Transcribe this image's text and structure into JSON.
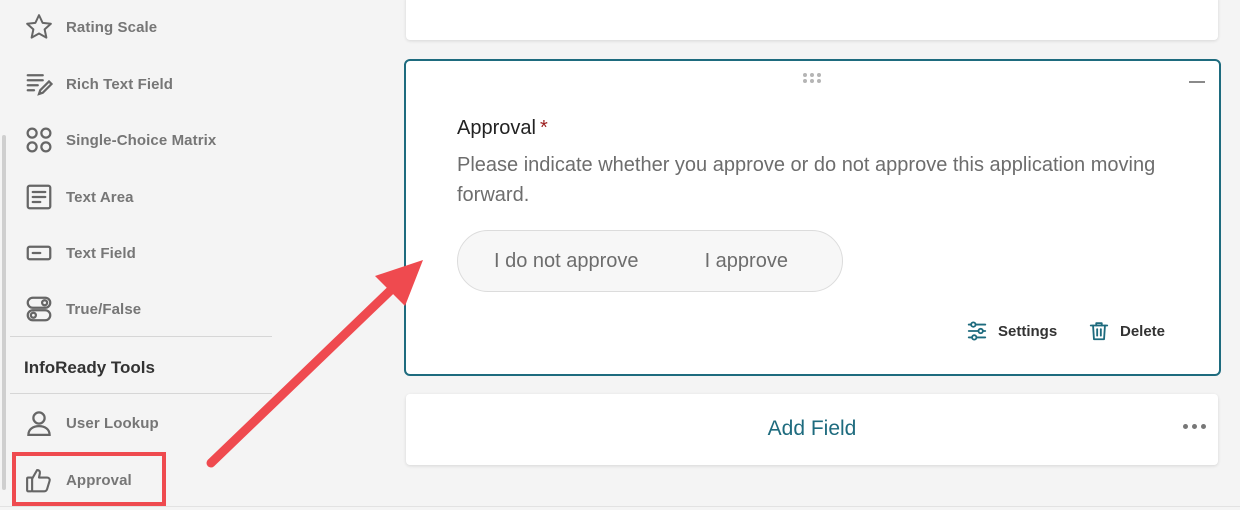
{
  "sidebar": {
    "items": [
      {
        "label": "Rating Scale",
        "icon": "star-icon"
      },
      {
        "label": "Rich Text Field",
        "icon": "rich-text-icon"
      },
      {
        "label": "Single-Choice Matrix",
        "icon": "matrix-icon"
      },
      {
        "label": "Text Area",
        "icon": "text-area-icon"
      },
      {
        "label": "Text Field",
        "icon": "text-field-icon"
      },
      {
        "label": "True/False",
        "icon": "toggle-icon"
      }
    ],
    "section_title": "InfoReady Tools",
    "tools": [
      {
        "label": "User Lookup",
        "icon": "user-icon"
      },
      {
        "label": "Approval",
        "icon": "thumbs-up-icon"
      }
    ]
  },
  "field_card": {
    "title": "Approval",
    "required_mark": "*",
    "description": "Please indicate whether you approve or do not approve this application moving forward.",
    "options": [
      "I do not approve",
      "I approve"
    ],
    "settings_label": "Settings",
    "delete_label": "Delete"
  },
  "add_field_label": "Add Field",
  "colors": {
    "accent": "#1e6b7e",
    "annotation": "#ef4a4f",
    "required": "#9b1c1c"
  }
}
